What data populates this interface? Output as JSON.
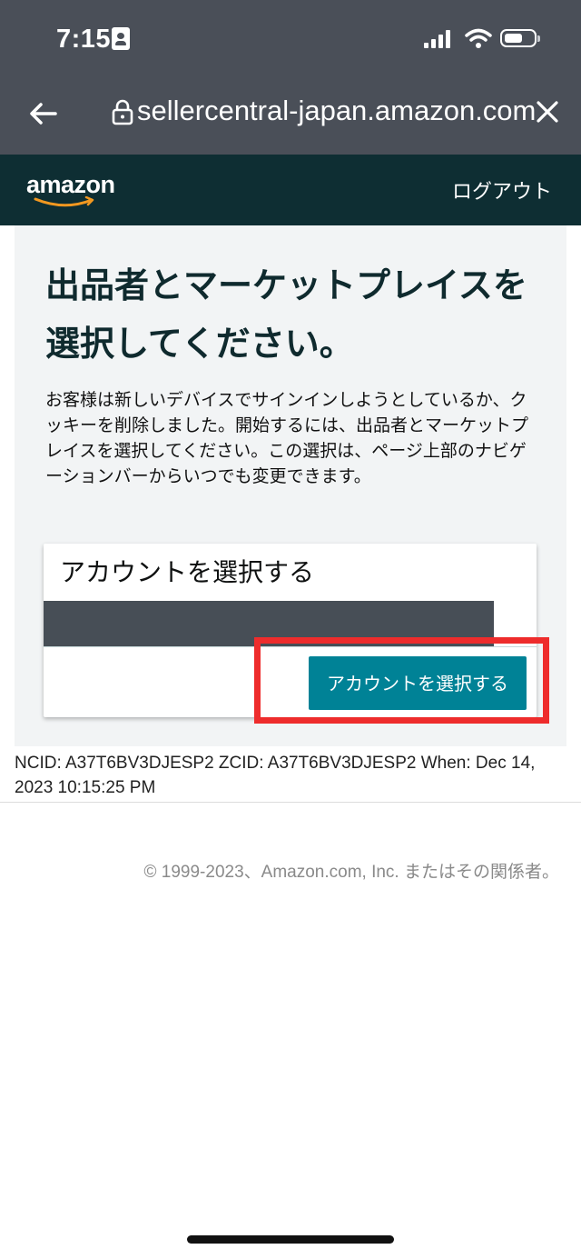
{
  "status_bar": {
    "time": "7:15"
  },
  "browser": {
    "url": "sellercentral-japan.amazon.com"
  },
  "header": {
    "logo": "amazon",
    "logout_label": "ログアウト"
  },
  "main": {
    "title": "出品者とマーケットプレイスを選択してください。",
    "description": "お客様は新しいデバイスでサインインしようとしているか、クッキーを削除しました。開始するには、出品者とマーケットプレイスを選択してください。この選択は、ページ上部のナビゲーションバーからいつでも変更できます。",
    "card": {
      "title": "アカウントを選択する",
      "button_label": "アカウントを選択する"
    }
  },
  "footer": {
    "ncid_info": "NCID: A37T6BV3DJESP2 ZCID: A37T6BV3DJESP2 When: Dec 14, 2023 10:15:25 PM",
    "copyright": "© 1999-2023、Amazon.com, Inc. またはその関係者。"
  },
  "colors": {
    "status_bar": "#4a4f58",
    "amazon_header": "#0e2e33",
    "primary_button": "#008296",
    "highlight": "#ee2c2c",
    "smile": "#f29820"
  }
}
